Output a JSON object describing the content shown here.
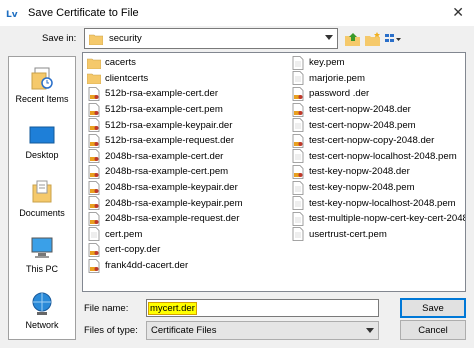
{
  "window": {
    "title": "Save Certificate to File",
    "app_icon": "Lv"
  },
  "save_in": {
    "label": "Save in:",
    "value": "security"
  },
  "places": [
    {
      "label": "Recent Items",
      "icon": "recent-items-icon"
    },
    {
      "label": "Desktop",
      "icon": "desktop-icon"
    },
    {
      "label": "Documents",
      "icon": "documents-icon"
    },
    {
      "label": "This PC",
      "icon": "this-pc-icon"
    },
    {
      "label": "Network",
      "icon": "network-icon"
    }
  ],
  "files": {
    "col1": [
      {
        "name": "cacerts",
        "type": "folder"
      },
      {
        "name": "clientcerts",
        "type": "folder"
      },
      {
        "name": "512b-rsa-example-cert.der",
        "type": "cert"
      },
      {
        "name": "512b-rsa-example-cert.pem",
        "type": "cert"
      },
      {
        "name": "512b-rsa-example-keypair.der",
        "type": "cert"
      },
      {
        "name": "512b-rsa-example-request.der",
        "type": "cert"
      },
      {
        "name": "2048b-rsa-example-cert.der",
        "type": "cert"
      },
      {
        "name": "2048b-rsa-example-cert.pem",
        "type": "cert"
      },
      {
        "name": "2048b-rsa-example-keypair.der",
        "type": "cert"
      },
      {
        "name": "2048b-rsa-example-keypair.pem",
        "type": "cert"
      },
      {
        "name": "2048b-rsa-example-request.der",
        "type": "cert"
      },
      {
        "name": "cert.pem",
        "type": "doc"
      },
      {
        "name": "cert-copy.der",
        "type": "cert"
      },
      {
        "name": "frank4dd-cacert.der",
        "type": "cert"
      }
    ],
    "col2": [
      {
        "name": "key.pem",
        "type": "doc"
      },
      {
        "name": "marjorie.pem",
        "type": "doc"
      },
      {
        "name": "password .der",
        "type": "cert"
      },
      {
        "name": "test-cert-nopw-2048.der",
        "type": "cert"
      },
      {
        "name": "test-cert-nopw-2048.pem",
        "type": "doc"
      },
      {
        "name": "test-cert-nopw-copy-2048.der",
        "type": "cert"
      },
      {
        "name": "test-cert-nopw-localhost-2048.pem",
        "type": "doc"
      },
      {
        "name": "test-key-nopw-2048.der",
        "type": "cert"
      },
      {
        "name": "test-key-nopw-2048.pem",
        "type": "doc"
      },
      {
        "name": "test-key-nopw-localhost-2048.pem",
        "type": "doc"
      },
      {
        "name": "test-multiple-nopw-cert-key-cert-2048",
        "type": "doc"
      },
      {
        "name": "usertrust-cert.pem",
        "type": "doc"
      }
    ]
  },
  "file_name": {
    "label": "File name:",
    "value": "mycert.der"
  },
  "file_type": {
    "label": "Files of type:",
    "value": "Certificate Files"
  },
  "buttons": {
    "save": "Save",
    "cancel": "Cancel"
  },
  "colors": {
    "folder": "#f5c96b",
    "accent": "#0078d7",
    "highlight": "#ffff00",
    "cert_badge": "#e8a020"
  }
}
